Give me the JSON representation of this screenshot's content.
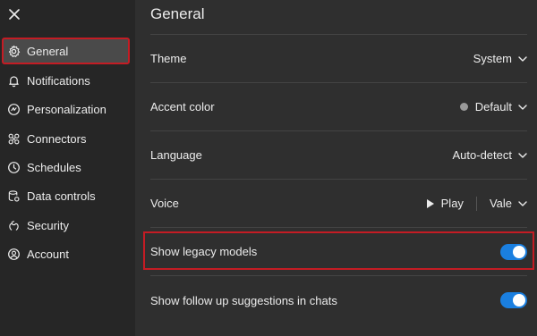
{
  "sidebar": {
    "items": [
      {
        "label": "General",
        "icon": "gear-icon",
        "active": true
      },
      {
        "label": "Notifications",
        "icon": "bell-icon"
      },
      {
        "label": "Personalization",
        "icon": "personalization-icon"
      },
      {
        "label": "Connectors",
        "icon": "connectors-icon"
      },
      {
        "label": "Schedules",
        "icon": "clock-icon"
      },
      {
        "label": "Data controls",
        "icon": "data-controls-icon"
      },
      {
        "label": "Security",
        "icon": "security-icon"
      },
      {
        "label": "Account",
        "icon": "account-icon"
      }
    ]
  },
  "main": {
    "title": "General",
    "settings": {
      "theme": {
        "label": "Theme",
        "value": "System"
      },
      "accent": {
        "label": "Accent color",
        "value": "Default",
        "swatch": "#9a9a9a"
      },
      "language": {
        "label": "Language",
        "value": "Auto-detect"
      },
      "voice": {
        "label": "Voice",
        "play_label": "Play",
        "value": "Vale"
      },
      "legacy": {
        "label": "Show legacy models",
        "enabled": true
      },
      "followup": {
        "label": "Show follow up suggestions in chats",
        "enabled": true
      }
    }
  },
  "colors": {
    "accent": "#1a7fe0",
    "highlight": "#c41c24"
  }
}
